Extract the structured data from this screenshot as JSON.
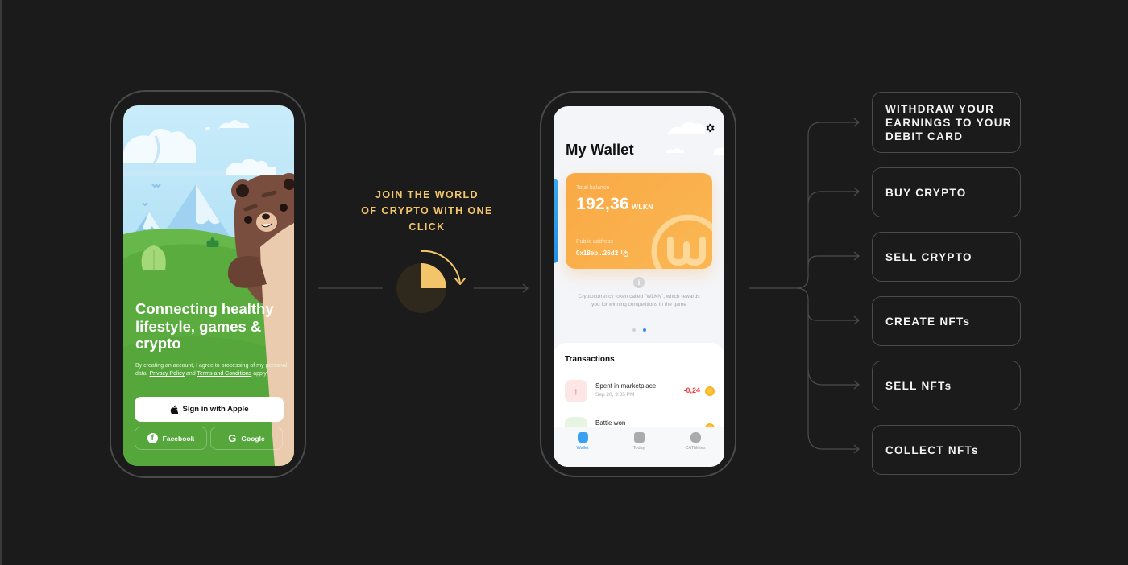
{
  "screen1": {
    "headline": "Connecting healthy lifestyle, games & crypto",
    "legal_prefix": "By creating an account, I agree to processing of my personal data. ",
    "privacy_link": "Privacy Policy",
    "legal_and": " and ",
    "terms_link": "Terms and Conditions",
    "legal_suffix": " apply.",
    "apple_button": "Sign in with Apple",
    "facebook_button": "Facebook",
    "google_button": "Google"
  },
  "middle": {
    "tagline": "JOIN THE WORLD OF CRYPTO WITH ONE CLICK",
    "tagline_lines": [
      "JOIN THE WORLD",
      "OF CRYPTO WITH ONE",
      "CLICK"
    ],
    "accent_color": "#f3c56a"
  },
  "screen2": {
    "title": "My Wallet",
    "card": {
      "balance_label": "Total balance",
      "balance_value": "192,36",
      "balance_unit": "WLKN",
      "address_label": "Public address",
      "address_value": "0x18eb...26d2"
    },
    "info_text": "Cryptocurrency token called \"WLKN\", which rewards you for winning competitions in the game",
    "carousel": {
      "total": 2,
      "active": 2
    },
    "transactions_title": "Transactions",
    "transactions": [
      {
        "name": "Spent in marketplace",
        "date": "Sep 20, 9:35 PM",
        "amount": "-0,24",
        "direction": "up"
      },
      {
        "name": "Battle won",
        "date": "",
        "amount": "",
        "direction": "down"
      }
    ],
    "tabs": [
      {
        "label": "Wallet",
        "icon": "wallet-icon",
        "active": true
      },
      {
        "label": "Today",
        "icon": "calendar-check-icon",
        "active": false
      },
      {
        "label": "CAThletes",
        "icon": "cat-icon",
        "active": false
      }
    ]
  },
  "options": [
    {
      "label": "WITHDRAW YOUR EARNINGS TO YOUR DEBIT CARD",
      "lines": [
        "WITHDRAW YOUR",
        "EARNINGS TO YOUR",
        "DEBIT CARD"
      ]
    },
    {
      "label": "BUY CRYPTO"
    },
    {
      "label": "SELL CRYPTO"
    },
    {
      "label": "CREATE NFTs"
    },
    {
      "label": "SELL NFTs"
    },
    {
      "label": "COLLECT NFTs"
    }
  ]
}
